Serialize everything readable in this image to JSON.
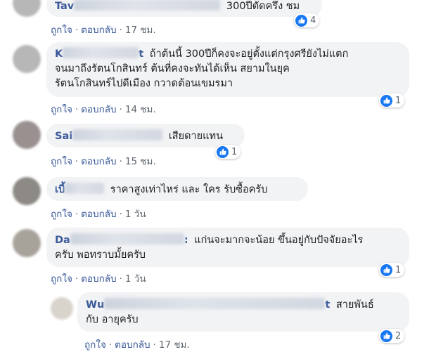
{
  "comments": [
    {
      "name_start": "Tav",
      "text": "300ปีตัดครึ่ง ชม",
      "reactions": "4",
      "like": "ถูกใจ",
      "reply": "ตอบกลับ",
      "time": "17 ชม."
    },
    {
      "name_start": "K",
      "name_end": "t",
      "line1": "ถ้าต้นนี้ 300ปีก็คงจะอยู่ตั้งแต่กรุงศรียังไม่แตก",
      "line2": "จนมาถึงรัตนโกสินทร์ ต้นที่คงจะทันได้เห็น สยามในยุค",
      "line3": "รัตนโกสินทร์ไปดีเมือง กวาดต้อนเขมรมา",
      "reactions": "1",
      "like": "ถูกใจ",
      "reply": "ตอบกลับ",
      "time": "14 ชม."
    },
    {
      "name_start": "Sai",
      "text": "เสียดายแทน",
      "reactions": "1",
      "like": "ถูกใจ",
      "reply": "ตอบกลับ",
      "time": "15 ชม."
    },
    {
      "name_start": "เบี้",
      "text": "ราคาสูงเท่าไหร่ และ ใคร รับซื้อครับ",
      "like": "ถูกใจ",
      "reply": "ตอบกลับ",
      "time": "1 วัน"
    },
    {
      "name_start": "Da",
      "name_end": ":",
      "line1": "แก่นจะมากจะน้อย ขึ้นอยู่กับปัจจัยอะไร",
      "line2": "ครับ พอทราบมั้ยครับ",
      "reactions": "1",
      "like": "ถูกใจ",
      "reply": "ตอบกลับ",
      "time": "1 วัน"
    },
    {
      "name_start": "Wu",
      "name_end": "t",
      "line1": "สายพันธ์",
      "line2": "กับ อายุครับ",
      "reactions": "2",
      "like": "ถูกใจ",
      "reply": "ตอบกลับ",
      "time": "17 ชม."
    }
  ],
  "separator": "·"
}
